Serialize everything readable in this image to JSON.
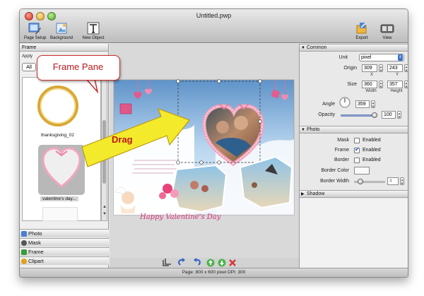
{
  "window": {
    "title": "Untitled.pwp",
    "status_text": "Page:  800 x 600 pixel DPI:  300"
  },
  "toolbar": {
    "page_setup": "Page Setup",
    "background": "Background",
    "new_object": "New Object",
    "export": "Export",
    "view": "View"
  },
  "left_pane": {
    "header": "Frame",
    "apply_label": "Apply",
    "filter_value": "All",
    "frames": [
      {
        "label": "thanksgiving_02",
        "selected": false
      },
      {
        "label": "valentine's day...",
        "selected": true
      }
    ],
    "categories": [
      {
        "label": "Photo",
        "icon": "photo-icon",
        "color": "#4a7fd1"
      },
      {
        "label": "Mask",
        "icon": "mask-icon",
        "color": "#555555"
      },
      {
        "label": "Frame",
        "icon": "frame-icon",
        "color": "#3a9b3a"
      },
      {
        "label": "Clipart",
        "icon": "clipart-icon",
        "color": "#e2a01c"
      }
    ]
  },
  "canvas": {
    "script_text": "Happy Valentine's Day"
  },
  "annotations": {
    "callout": "Frame Pane",
    "arrow_label": "Drag"
  },
  "properties": {
    "common": {
      "title": "Common",
      "unit_label": "Unit",
      "unit_value": "pixel",
      "origin_label": "Origin",
      "origin_x": "309",
      "origin_y": "243",
      "x_label": "X",
      "y_label": "Y",
      "size_label": "Size",
      "width": "360",
      "height": "357",
      "width_label": "Width",
      "height_label": "Height",
      "angle_label": "Angle",
      "angle_value": "359",
      "opacity_label": "Opacity",
      "opacity_value": "100",
      "opacity_level": 1.0
    },
    "photo": {
      "title": "Photo",
      "mask_label": "Mask",
      "frame_label": "Frame",
      "border_label": "Border",
      "enabled_label": "Enabled",
      "mask_enabled": false,
      "frame_enabled": true,
      "border_enabled": false,
      "border_color_label": "Border Color",
      "border_width_label": "Border Width",
      "border_width_value": "4",
      "border_width_level": 0.2
    },
    "shadow": {
      "title": "Shadow"
    }
  },
  "colors": {
    "accent": "#3b73d1",
    "callout_red": "#c92a2a",
    "arrow_yellow": "#f3ea2b",
    "heart_pink": "#f2a3bd"
  }
}
